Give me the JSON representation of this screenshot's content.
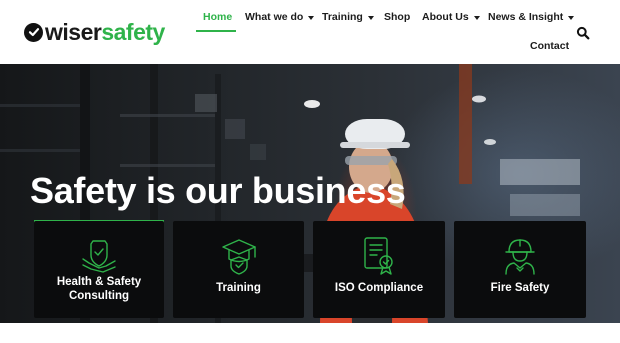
{
  "brand": {
    "logo_wiser": "wiser",
    "logo_safety": "safety",
    "green": "#2fb34a",
    "dark": "#1a1a1a"
  },
  "nav": {
    "home": "Home",
    "what_we_do": "What we do",
    "training": "Training",
    "shop": "Shop",
    "about_us": "About Us",
    "news_insight": "News & Insight",
    "contact": "Contact",
    "active": "Home",
    "search_icon": "search-icon"
  },
  "hero": {
    "title": "Safety is our business",
    "cards": [
      {
        "label": "Health & Safety Consulting",
        "icon": "hands-shield-icon"
      },
      {
        "label": "Training",
        "icon": "graduation-cap-shield-icon"
      },
      {
        "label": "ISO Compliance",
        "icon": "certificate-icon"
      },
      {
        "label": "Fire Safety",
        "icon": "firefighter-icon"
      }
    ]
  }
}
